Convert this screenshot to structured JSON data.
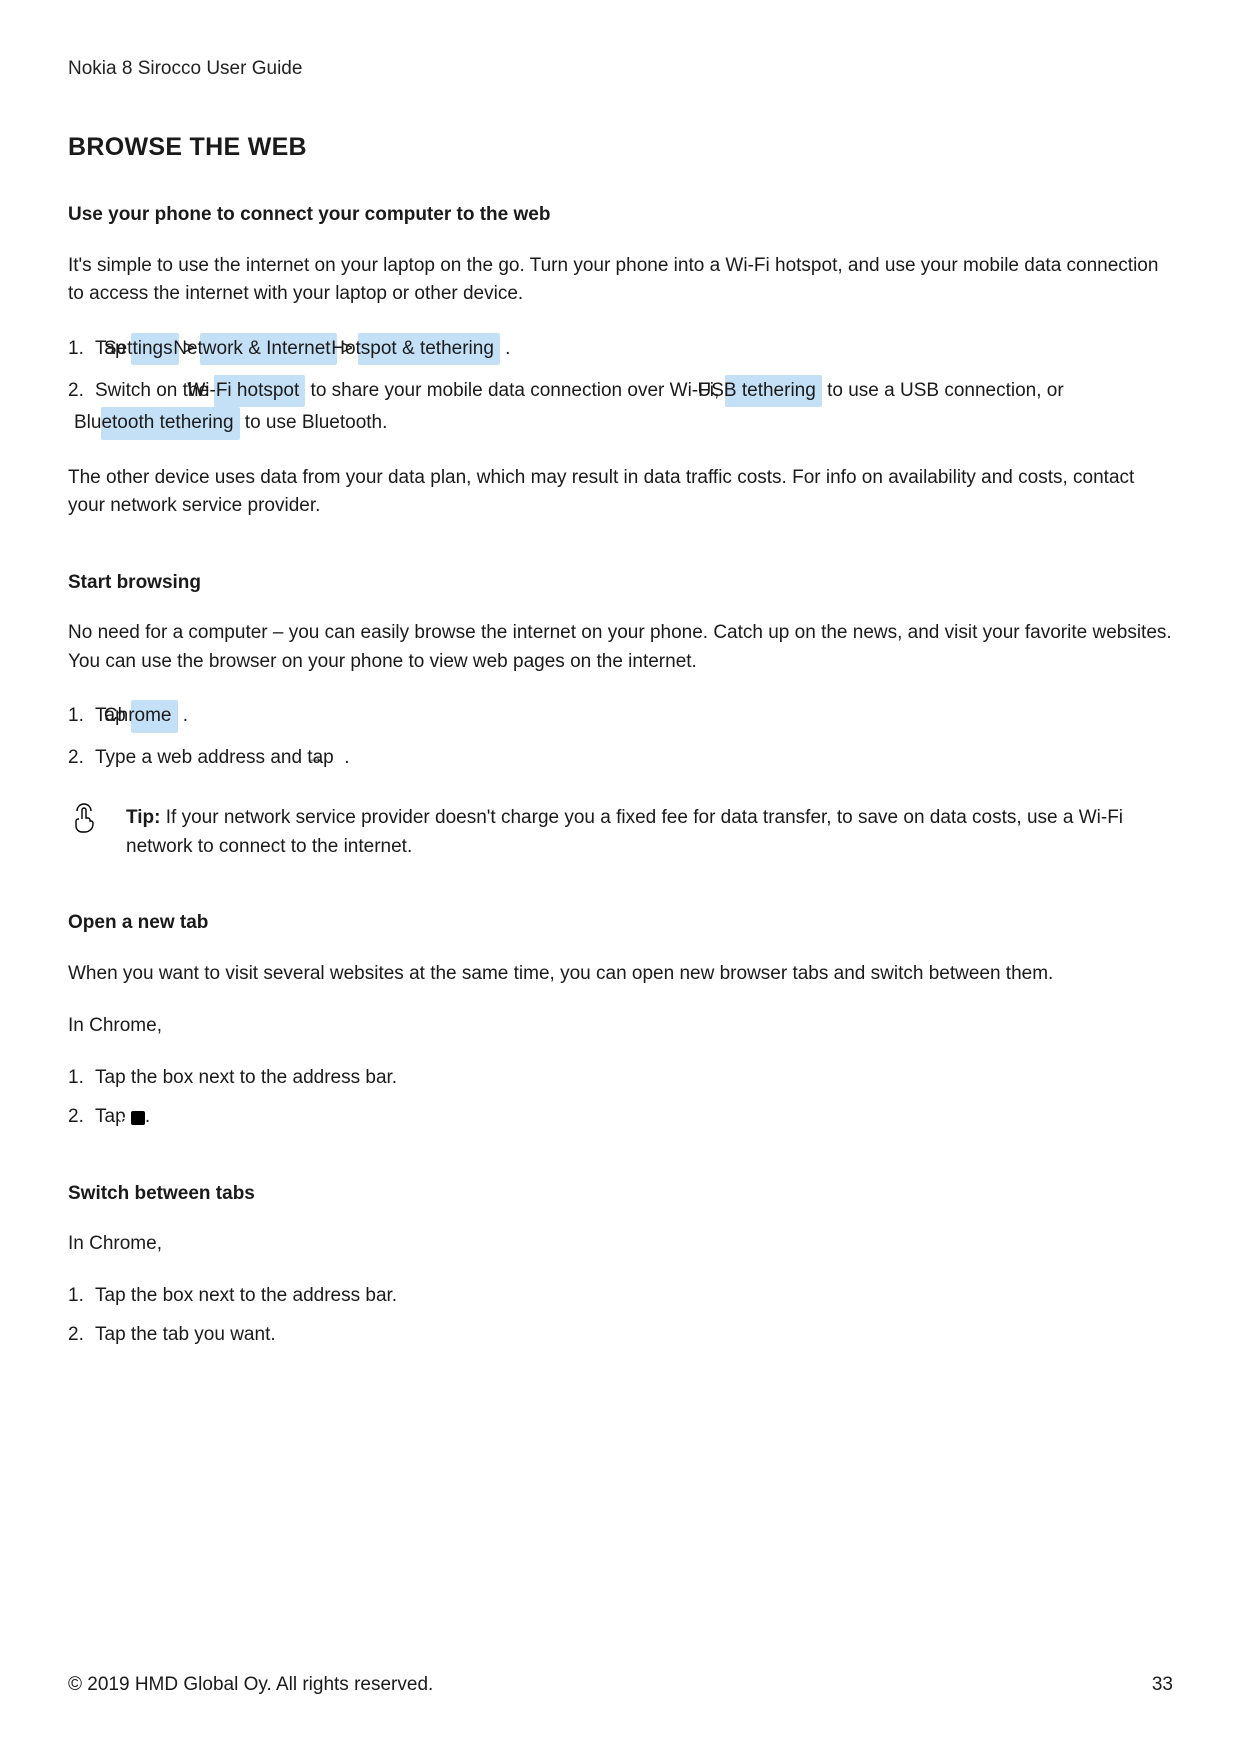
{
  "header": {
    "title": "Nokia 8 Sirocco User Guide"
  },
  "page_title": "BROWSE THE WEB",
  "sections": {
    "s1": {
      "heading": "Use your phone to connect your computer to the web",
      "intro": "It's simple to use the internet on your laptop on the go. Turn your phone into a Wi-Fi hotspot, and use your mobile data connection to access the internet with your laptop or other device.",
      "step1_prefix": "Tap ",
      "step1_chip1": "Settings",
      "step1_sep1": " > ",
      "step1_chip2": "Network & Internet",
      "step1_sep2": " > ",
      "step1_chip3": "Hotspot & tethering",
      "step1_suffix": " .",
      "step2_a": "Switch on the ",
      "step2_chip1": "Wi-Fi hotspot",
      "step2_b": " to share your mobile data connection over Wi-Fi, ",
      "step2_chip2": "USB tethering",
      "step2_c": " to use a USB connection, or ",
      "step2_chip3": "Bluetooth tethering",
      "step2_d": " to use Bluetooth.",
      "note": "The other device uses data from your data plan, which may result in data traffic costs. For info on availability and costs, contact your network service provider."
    },
    "s2": {
      "heading": "Start browsing",
      "intro": "No need for a computer – you can easily browse the internet on your phone. Catch up on the news, and visit your favorite websites. You can use the browser on your phone to view web pages on the internet.",
      "step1_prefix": "Tap ",
      "step1_chip": "Chrome",
      "step1_suffix": " .",
      "step2_a": "Type a web address and tap ",
      "step2_b": " .",
      "tip_label": "Tip:",
      "tip_text": " If your network service provider doesn't charge you a fixed fee for data transfer, to save on data costs, use a Wi-Fi network to connect to the internet."
    },
    "s3": {
      "heading": "Open a new tab",
      "intro": "When you want to visit several websites at the same time, you can open new browser tabs and switch between them.",
      "context": "In Chrome,",
      "step1": "Tap the box next to the address bar.",
      "step2_a": "Tap ",
      "step2_b": "."
    },
    "s4": {
      "heading": "Switch between tabs",
      "context": "In Chrome,",
      "step1": "Tap the box next to the address bar.",
      "step2": "Tap the tab you want."
    }
  },
  "nums": {
    "n1": "1.",
    "n2": "2."
  },
  "footer": {
    "copyright": "© 2019 HMD Global Oy. All rights reserved.",
    "page": "33"
  }
}
